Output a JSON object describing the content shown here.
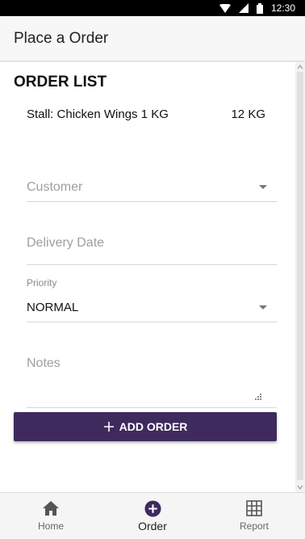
{
  "status_bar": {
    "time": "12:30"
  },
  "app_bar": {
    "title": "Place a Order"
  },
  "order_list": {
    "heading": "ORDER LIST",
    "items": [
      {
        "name": "Stall: Chicken Wings 1 KG",
        "quantity": "12 KG"
      }
    ]
  },
  "form": {
    "customer": {
      "placeholder": "Customer"
    },
    "delivery_date": {
      "placeholder": "Delivery Date"
    },
    "priority": {
      "label": "Priority",
      "value": "NORMAL"
    },
    "notes": {
      "placeholder": "Notes"
    }
  },
  "add_button": {
    "label": "ADD ORDER"
  },
  "bottom_nav": {
    "items": [
      {
        "label": "Home",
        "icon": "home-icon",
        "active": false
      },
      {
        "label": "Order",
        "icon": "add-circle-icon",
        "active": true
      },
      {
        "label": "Report",
        "icon": "grid-icon",
        "active": false
      }
    ]
  },
  "colors": {
    "accent": "#3f2a5e",
    "status_bar": "#000000"
  }
}
